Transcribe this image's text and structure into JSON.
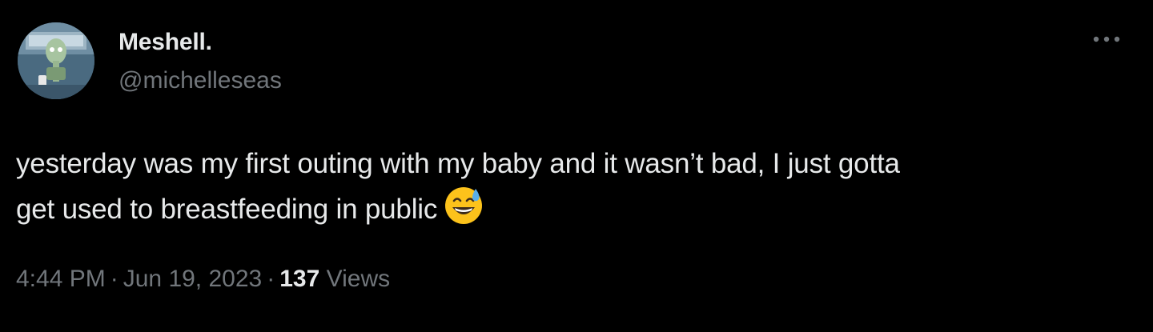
{
  "tweet": {
    "author": {
      "display_name": "Meshell.",
      "handle": "@michelleseas",
      "avatar_icon": "avatar-image"
    },
    "more_icon": "more-horizontal-icon",
    "text_line_1": "yesterday was my first outing with my baby and it wasn’t bad, I just gotta",
    "text_line_2": "get used to breastfeeding in public",
    "emoji_icon": "grinning-face-with-sweat-emoji",
    "time": "4:44 PM",
    "separator": "·",
    "date": "Jun 19, 2023",
    "views_count": "137",
    "views_label": "Views"
  },
  "colors": {
    "background": "#000000",
    "primary_text": "#e7e9ea",
    "secondary_text": "#71767b"
  }
}
